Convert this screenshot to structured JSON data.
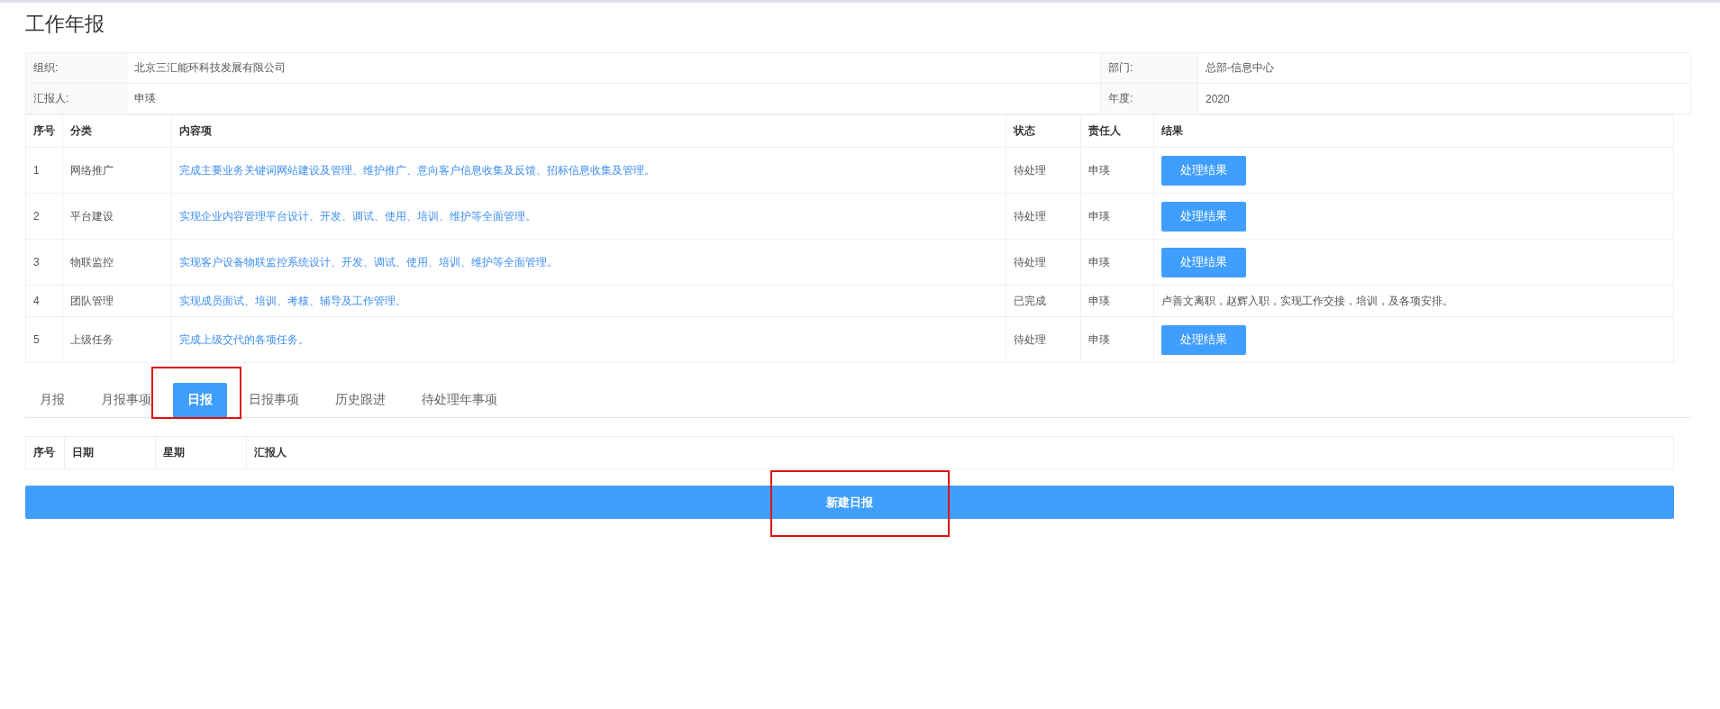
{
  "title": "工作年报",
  "info": [
    {
      "label": "组织:",
      "value": "北京三汇能环科技发展有限公司",
      "label2": "部门:",
      "value2": "总部-信息中心"
    },
    {
      "label": "汇报人:",
      "value": "申瑛",
      "label2": "年度:",
      "value2": "2020"
    }
  ],
  "table": {
    "columns": [
      "序号",
      "分类",
      "内容项",
      "状态",
      "责任人",
      "结果"
    ],
    "rows": [
      {
        "no": "1",
        "category": "网络推广",
        "content": "完成主要业务关键词网站建设及管理、维护推广、意向客户信息收集及反馈、招标信息收集及管理。",
        "status": "待处理",
        "owner": "申瑛",
        "kind": "button",
        "result": "处理结果"
      },
      {
        "no": "2",
        "category": "平台建设",
        "content": "实现企业内容管理平台设计、开发、调试、使用、培训、维护等全面管理。",
        "status": "待处理",
        "owner": "申瑛",
        "kind": "button",
        "result": "处理结果"
      },
      {
        "no": "3",
        "category": "物联监控",
        "content": "实现客户设备物联监控系统设计、开发、调试、使用、培训、维护等全面管理。",
        "status": "待处理",
        "owner": "申瑛",
        "kind": "button",
        "result": "处理结果"
      },
      {
        "no": "4",
        "category": "团队管理",
        "content": "实现成员面试、培训、考核、辅导及工作管理。",
        "status": "已完成",
        "owner": "申瑛",
        "kind": "text",
        "result": "卢善文离职，赵辉入职，实现工作交接，培训，及各项安排。"
      },
      {
        "no": "5",
        "category": "上级任务",
        "content": "完成上级交代的各项任务。",
        "status": "待处理",
        "owner": "申瑛",
        "kind": "button",
        "result": "处理结果"
      }
    ]
  },
  "tabs": [
    {
      "label": "月报",
      "selected": false
    },
    {
      "label": "月报事项",
      "selected": false
    },
    {
      "label": "日报",
      "selected": true
    },
    {
      "label": "日报事项",
      "selected": false
    },
    {
      "label": "历史跟进",
      "selected": false
    },
    {
      "label": "待处理年事项",
      "selected": false
    }
  ],
  "daily_table": {
    "columns": [
      "序号",
      "日期",
      "星期",
      "汇报人"
    ]
  },
  "new_button": "新建日报"
}
